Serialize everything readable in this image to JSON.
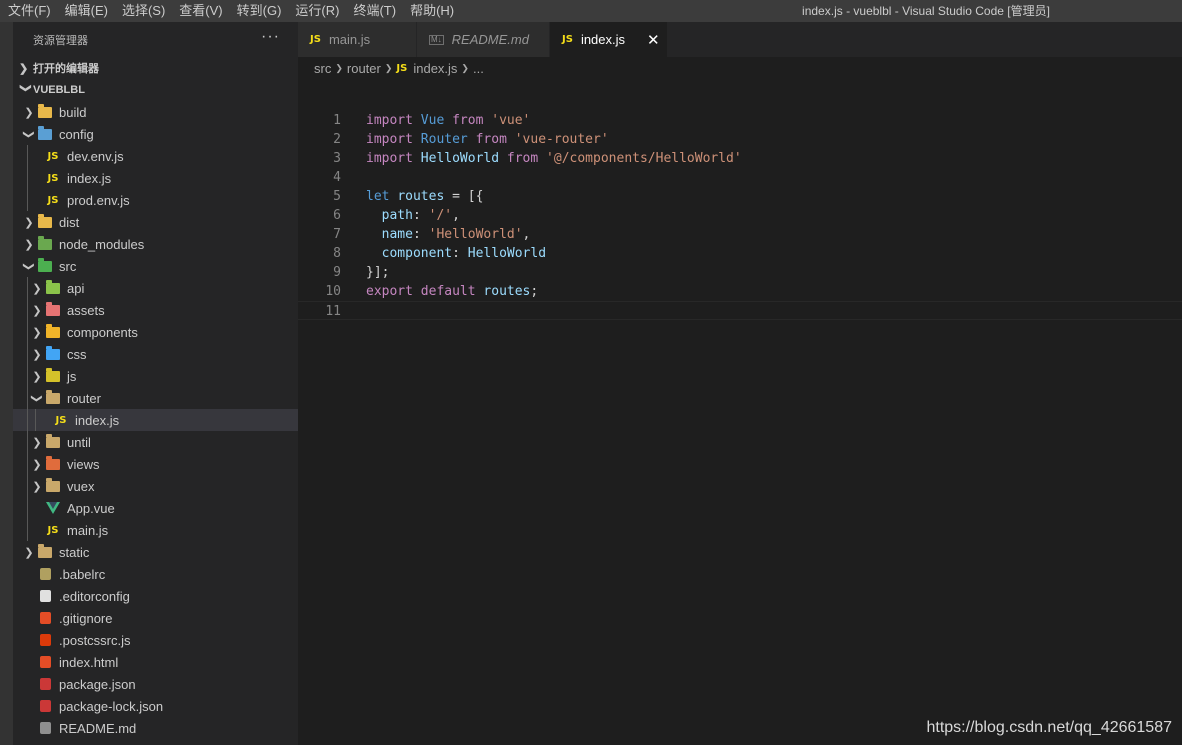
{
  "titlebar": {
    "menu": [
      "文件(F)",
      "编辑(E)",
      "选择(S)",
      "查看(V)",
      "转到(G)",
      "运行(R)",
      "终端(T)",
      "帮助(H)"
    ],
    "title": "index.js - vueblbl - Visual Studio Code [管理员]"
  },
  "explorer": {
    "header": "资源管理器",
    "more": "···",
    "open_editors": "打开的编辑器",
    "project": "VUEBLBL",
    "items": [
      {
        "label": "build",
        "type": "folder",
        "depth": 0,
        "expanded": false,
        "icon": "build-folder-icon",
        "color": "#e8b84a"
      },
      {
        "label": "config",
        "type": "folder",
        "depth": 0,
        "expanded": true,
        "icon": "config-folder-icon",
        "color": "#5a9fd4"
      },
      {
        "label": "dev.env.js",
        "type": "js",
        "depth": 1
      },
      {
        "label": "index.js",
        "type": "js",
        "depth": 1
      },
      {
        "label": "prod.env.js",
        "type": "js",
        "depth": 1
      },
      {
        "label": "dist",
        "type": "folder",
        "depth": 0,
        "expanded": false,
        "icon": "dist-folder-icon",
        "color": "#e8b84a"
      },
      {
        "label": "node_modules",
        "type": "folder",
        "depth": 0,
        "expanded": false,
        "icon": "node-modules-folder-icon",
        "color": "#6aa84f"
      },
      {
        "label": "src",
        "type": "folder",
        "depth": 0,
        "expanded": true,
        "icon": "src-folder-icon",
        "color": "#4caf50"
      },
      {
        "label": "api",
        "type": "folder",
        "depth": 1,
        "expanded": false,
        "icon": "api-folder-icon",
        "color": "#8bc34a"
      },
      {
        "label": "assets",
        "type": "folder",
        "depth": 1,
        "expanded": false,
        "icon": "assets-folder-icon",
        "color": "#e57373"
      },
      {
        "label": "components",
        "type": "folder",
        "depth": 1,
        "expanded": false,
        "icon": "components-folder-icon",
        "color": "#f0b429"
      },
      {
        "label": "css",
        "type": "folder",
        "depth": 1,
        "expanded": false,
        "icon": "css-folder-icon",
        "color": "#42a5f5"
      },
      {
        "label": "js",
        "type": "folder",
        "depth": 1,
        "expanded": false,
        "icon": "js-folder-icon",
        "color": "#d4c12a"
      },
      {
        "label": "router",
        "type": "folder",
        "depth": 1,
        "expanded": true,
        "icon": "router-folder-open-icon",
        "color": "#c9a86a"
      },
      {
        "label": "index.js",
        "type": "js",
        "depth": 2,
        "selected": true
      },
      {
        "label": "until",
        "type": "folder",
        "depth": 1,
        "expanded": false,
        "icon": "until-folder-icon",
        "color": "#c9a86a"
      },
      {
        "label": "views",
        "type": "folder",
        "depth": 1,
        "expanded": false,
        "icon": "views-folder-icon",
        "color": "#e06c3c"
      },
      {
        "label": "vuex",
        "type": "folder",
        "depth": 1,
        "expanded": false,
        "icon": "vuex-folder-icon",
        "color": "#c9a86a"
      },
      {
        "label": "App.vue",
        "type": "vue",
        "depth": 1
      },
      {
        "label": "main.js",
        "type": "js",
        "depth": 1
      },
      {
        "label": "static",
        "type": "folder",
        "depth": 0,
        "expanded": false,
        "icon": "static-folder-icon",
        "color": "#c9a86a"
      },
      {
        "label": ".babelrc",
        "type": "file",
        "depth": 0,
        "icon": "babel-file-icon",
        "color": "#b0a060"
      },
      {
        "label": ".editorconfig",
        "type": "file",
        "depth": 0,
        "icon": "editorconfig-file-icon",
        "color": "#e0e0e0"
      },
      {
        "label": ".gitignore",
        "type": "file",
        "depth": 0,
        "icon": "git-file-icon",
        "color": "#e44d26"
      },
      {
        "label": ".postcssrc.js",
        "type": "file",
        "depth": 0,
        "icon": "postcss-file-icon",
        "color": "#dd3a0a"
      },
      {
        "label": "index.html",
        "type": "file",
        "depth": 0,
        "icon": "html-file-icon",
        "color": "#e44d26"
      },
      {
        "label": "package.json",
        "type": "file",
        "depth": 0,
        "icon": "npm-file-icon",
        "color": "#cb3837"
      },
      {
        "label": "package-lock.json",
        "type": "file",
        "depth": 0,
        "icon": "npm-file-icon",
        "color": "#cb3837"
      },
      {
        "label": "README.md",
        "type": "file",
        "depth": 0,
        "icon": "markdown-file-icon",
        "color": "#8f8f8f"
      }
    ]
  },
  "tabs": [
    {
      "label": "main.js",
      "kind": "js",
      "active": false
    },
    {
      "label": "README.md",
      "kind": "md",
      "active": false
    },
    {
      "label": "index.js",
      "kind": "js",
      "active": true
    }
  ],
  "tab_close": "✕",
  "breadcrumb": {
    "parts": [
      "src",
      "router",
      "index.js",
      "..."
    ]
  },
  "code": {
    "current_line": 11,
    "lines": [
      [
        [
          "kw",
          "import"
        ],
        [
          "pun",
          " "
        ],
        [
          "kw2",
          "Vue"
        ],
        [
          "pun",
          " "
        ],
        [
          "kw",
          "from"
        ],
        [
          "pun",
          " "
        ],
        [
          "str",
          "'vue'"
        ]
      ],
      [
        [
          "kw",
          "import"
        ],
        [
          "pun",
          " "
        ],
        [
          "kw2",
          "Router"
        ],
        [
          "pun",
          " "
        ],
        [
          "kw",
          "from"
        ],
        [
          "pun",
          " "
        ],
        [
          "str",
          "'vue-router'"
        ]
      ],
      [
        [
          "kw",
          "import"
        ],
        [
          "pun",
          " "
        ],
        [
          "id",
          "HelloWorld"
        ],
        [
          "pun",
          " "
        ],
        [
          "kw",
          "from"
        ],
        [
          "pun",
          " "
        ],
        [
          "str",
          "'@/components/HelloWorld'"
        ]
      ],
      [],
      [
        [
          "kw2",
          "let"
        ],
        [
          "pun",
          " "
        ],
        [
          "id",
          "routes"
        ],
        [
          "pun",
          " = [{"
        ]
      ],
      [
        [
          "pun",
          "  "
        ],
        [
          "id",
          "path"
        ],
        [
          "pun",
          ": "
        ],
        [
          "str",
          "'/'"
        ],
        [
          "pun",
          ","
        ]
      ],
      [
        [
          "pun",
          "  "
        ],
        [
          "id",
          "name"
        ],
        [
          "pun",
          ": "
        ],
        [
          "str",
          "'HelloWorld'"
        ],
        [
          "pun",
          ","
        ]
      ],
      [
        [
          "pun",
          "  "
        ],
        [
          "id",
          "component"
        ],
        [
          "pun",
          ": "
        ],
        [
          "id",
          "HelloWorld"
        ]
      ],
      [
        [
          "pun",
          "}];"
        ]
      ],
      [
        [
          "kw",
          "export"
        ],
        [
          "pun",
          " "
        ],
        [
          "kw",
          "default"
        ],
        [
          "pun",
          " "
        ],
        [
          "id",
          "routes"
        ],
        [
          "pun",
          ";"
        ]
      ],
      []
    ]
  },
  "watermark": "https://blog.csdn.net/qq_42661587"
}
